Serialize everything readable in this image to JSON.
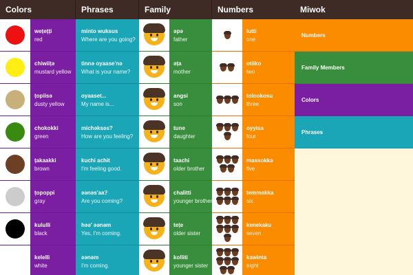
{
  "colors": {
    "title": "Colors",
    "items": [
      {
        "miwok": "weṭeṭṭi",
        "english": "red",
        "swatch": "#ee1111"
      },
      {
        "miwok": "chiwiiṭә",
        "english": "mustard yellow",
        "swatch": "#ffee11"
      },
      {
        "miwok": "ṭopiisә",
        "english": "dusty yellow",
        "swatch": "#c8b07a"
      },
      {
        "miwok": "chokokki",
        "english": "green",
        "swatch": "#3a8a12"
      },
      {
        "miwok": "ṭakaakki",
        "english": "brown",
        "swatch": "#6d4026"
      },
      {
        "miwok": "ṭopoppi",
        "english": "gray",
        "swatch": "#cccccc"
      },
      {
        "miwok": "kululli",
        "english": "black",
        "swatch": "#000000"
      },
      {
        "miwok": "kelelli",
        "english": "white",
        "swatch": "#ffffff"
      }
    ]
  },
  "phrases": {
    "title": "Phrases",
    "items": [
      {
        "miwok": "minto wuksus",
        "english": "Where are you going?"
      },
      {
        "miwok": "tinnә oyaase'nә",
        "english": "What is your name?"
      },
      {
        "miwok": "oyaaset...",
        "english": "My name is..."
      },
      {
        "miwok": "michәksәs?",
        "english": "How are you feeling?"
      },
      {
        "miwok": "kuchi achit",
        "english": "I'm feeling good."
      },
      {
        "miwok": "әәnәs'aa?",
        "english": "Are you coming?"
      },
      {
        "miwok": "hәә' әәnәm",
        "english": "Yes, I'm coming."
      },
      {
        "miwok": "әәnәm",
        "english": "I'm coming."
      }
    ]
  },
  "family": {
    "title": "Family",
    "items": [
      {
        "miwok": "әpә",
        "english": "father"
      },
      {
        "miwok": "әṭa",
        "english": "mother"
      },
      {
        "miwok": "angsi",
        "english": "son"
      },
      {
        "miwok": "tune",
        "english": "daughter"
      },
      {
        "miwok": "taachi",
        "english": "older brother"
      },
      {
        "miwok": "chalitti",
        "english": "younger brother"
      },
      {
        "miwok": "teṭe",
        "english": "older sister"
      },
      {
        "miwok": "kolliti",
        "english": "younger sister"
      }
    ]
  },
  "numbers": {
    "title": "Numbers",
    "items": [
      {
        "miwok": "lutti",
        "english": "one",
        "count": 1
      },
      {
        "miwok": "otiiko",
        "english": "two",
        "count": 2
      },
      {
        "miwok": "tolookosu",
        "english": "three",
        "count": 3
      },
      {
        "miwok": "oyyisa",
        "english": "four",
        "count": 4
      },
      {
        "miwok": "massokka",
        "english": "five",
        "count": 5
      },
      {
        "miwok": "temmokka",
        "english": "six",
        "count": 6
      },
      {
        "miwok": "kenekaku",
        "english": "seven",
        "count": 7
      },
      {
        "miwok": "kawinta",
        "english": "eight",
        "count": 8
      }
    ]
  },
  "miwok_menu": {
    "title": "Miwok",
    "items": [
      {
        "label": "Numbers",
        "color": "#fb8c00"
      },
      {
        "label": "Family Members",
        "color": "#388e3c"
      },
      {
        "label": "Colors",
        "color": "#7b1fa2"
      },
      {
        "label": "Phrases",
        "color": "#1aa6b7"
      }
    ]
  }
}
